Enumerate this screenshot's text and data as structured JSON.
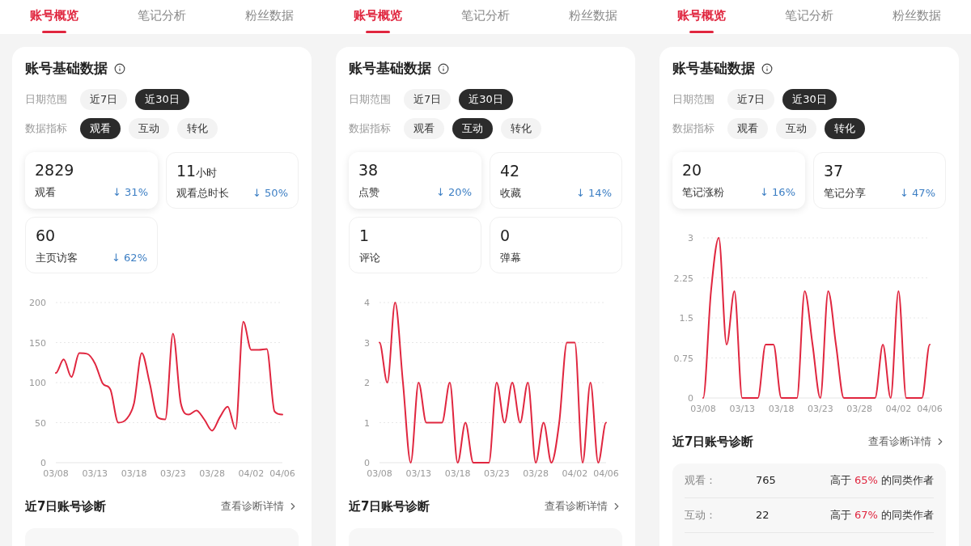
{
  "panels": [
    {
      "tabs": [
        {
          "label": "账号概览",
          "selected": true
        },
        {
          "label": "笔记分析",
          "selected": false
        },
        {
          "label": "粉丝数据",
          "selected": false
        }
      ],
      "title": "账号基础数据",
      "date_range": {
        "label": "日期范围",
        "options": [
          {
            "label": "近7日",
            "selected": false
          },
          {
            "label": "近30日",
            "selected": true
          }
        ]
      },
      "metric_type": {
        "label": "数据指标",
        "options": [
          {
            "label": "观看",
            "selected": true
          },
          {
            "label": "互动",
            "selected": false
          },
          {
            "label": "转化",
            "selected": false
          }
        ]
      },
      "metrics": [
        {
          "value": "2829",
          "label": "观看",
          "change": "↓ 31%",
          "selected": true
        },
        {
          "value": "11",
          "unit": "小时",
          "label": "观看总时长",
          "change": "↓ 50%",
          "selected": false
        },
        {
          "value": "60",
          "label": "主页访客",
          "change": "↓ 62%",
          "selected": false
        }
      ],
      "chart_data": {
        "type": "line",
        "categories": [
          "03/08",
          null,
          null,
          null,
          null,
          "03/13",
          null,
          null,
          null,
          null,
          "03/18",
          null,
          null,
          null,
          null,
          "03/23",
          null,
          null,
          null,
          null,
          "03/28",
          null,
          null,
          null,
          null,
          "04/02",
          null,
          null,
          null,
          "04/06"
        ],
        "ylim": [
          0,
          200
        ],
        "grid": true,
        "series": [
          {
            "color": "#e0263f",
            "values": [
              112,
              129,
              107,
              137,
              136,
              124,
              99,
              91,
              50,
              54,
              74,
              137,
              100,
              57,
              54,
              161,
              74,
              60,
              65,
              54,
              40,
              57,
              70,
              42,
              176,
              141,
              141,
              142,
              64,
              60
            ]
          }
        ],
        "yticks": [
          0,
          50,
          100,
          150,
          200
        ]
      },
      "diagnosis": {
        "title": "近7日账号诊断",
        "link": "查看诊断详情"
      }
    },
    {
      "tabs": [
        {
          "label": "账号概览",
          "selected": true
        },
        {
          "label": "笔记分析",
          "selected": false
        },
        {
          "label": "粉丝数据",
          "selected": false
        }
      ],
      "title": "账号基础数据",
      "date_range": {
        "label": "日期范围",
        "options": [
          {
            "label": "近7日",
            "selected": false
          },
          {
            "label": "近30日",
            "selected": true
          }
        ]
      },
      "metric_type": {
        "label": "数据指标",
        "options": [
          {
            "label": "观看",
            "selected": false
          },
          {
            "label": "互动",
            "selected": true
          },
          {
            "label": "转化",
            "selected": false
          }
        ]
      },
      "metrics": [
        {
          "value": "38",
          "label": "点赞",
          "change": "↓ 20%",
          "selected": true
        },
        {
          "value": "42",
          "label": "收藏",
          "change": "↓ 14%",
          "selected": false
        },
        {
          "value": "1",
          "label": "评论",
          "selected": false
        },
        {
          "value": "0",
          "label": "弹幕",
          "selected": false
        }
      ],
      "chart_data": {
        "type": "line",
        "categories": [
          "03/08",
          null,
          null,
          null,
          null,
          "03/13",
          null,
          null,
          null,
          null,
          "03/18",
          null,
          null,
          null,
          null,
          "03/23",
          null,
          null,
          null,
          null,
          "03/28",
          null,
          null,
          null,
          null,
          "04/02",
          null,
          null,
          null,
          "04/06"
        ],
        "ylim": [
          0,
          4
        ],
        "grid": true,
        "series": [
          {
            "color": "#e0263f",
            "values": [
              3,
              2,
              4,
              2,
              0,
              2,
              1,
              1,
              1,
              2,
              0,
              1,
              0,
              0,
              0,
              2,
              1,
              2,
              1,
              2,
              0,
              1,
              0,
              1,
              3,
              3,
              0,
              2,
              0,
              1
            ]
          }
        ],
        "yticks": [
          0,
          1,
          2,
          3,
          4
        ]
      },
      "diagnosis": {
        "title": "近7日账号诊断",
        "link": "查看诊断详情"
      }
    },
    {
      "tabs": [
        {
          "label": "账号概览",
          "selected": true
        },
        {
          "label": "笔记分析",
          "selected": false
        },
        {
          "label": "粉丝数据",
          "selected": false
        }
      ],
      "title": "账号基础数据",
      "date_range": {
        "label": "日期范围",
        "options": [
          {
            "label": "近7日",
            "selected": false
          },
          {
            "label": "近30日",
            "selected": true
          }
        ]
      },
      "metric_type": {
        "label": "数据指标",
        "options": [
          {
            "label": "观看",
            "selected": false
          },
          {
            "label": "互动",
            "selected": false
          },
          {
            "label": "转化",
            "selected": true
          }
        ]
      },
      "metrics": [
        {
          "value": "20",
          "label": "笔记涨粉",
          "change": "↓ 16%",
          "selected": true
        },
        {
          "value": "37",
          "label": "笔记分享",
          "change": "↓ 47%",
          "selected": false
        }
      ],
      "chart_data": {
        "type": "line",
        "categories": [
          "03/08",
          null,
          null,
          null,
          null,
          "03/13",
          null,
          null,
          null,
          null,
          "03/18",
          null,
          null,
          null,
          null,
          "03/23",
          null,
          null,
          null,
          null,
          "03/28",
          null,
          null,
          null,
          null,
          "04/02",
          null,
          null,
          null,
          "04/06"
        ],
        "ylim": [
          0,
          3
        ],
        "grid": true,
        "series": [
          {
            "color": "#e0263f",
            "values": [
              0,
              2,
              3,
              1,
              2,
              0,
              0,
              0,
              1,
              1,
              0,
              0,
              0,
              2,
              1,
              0,
              2,
              1,
              0,
              0,
              0,
              0,
              0,
              1,
              0,
              2,
              0,
              0,
              0,
              1
            ]
          }
        ],
        "yticks": [
          0,
          0.75,
          1.5,
          2.25,
          3
        ]
      },
      "diagnosis": {
        "title": "近7日账号诊断",
        "link": "查看诊断详情",
        "rows": [
          {
            "label": "观看：",
            "value": "765",
            "prefix": "高于",
            "percent": "65%",
            "suffix": "的同类作者"
          },
          {
            "label": "互动：",
            "value": "22",
            "prefix": "高于",
            "percent": "67%",
            "suffix": "的同类作者"
          }
        ]
      }
    }
  ]
}
